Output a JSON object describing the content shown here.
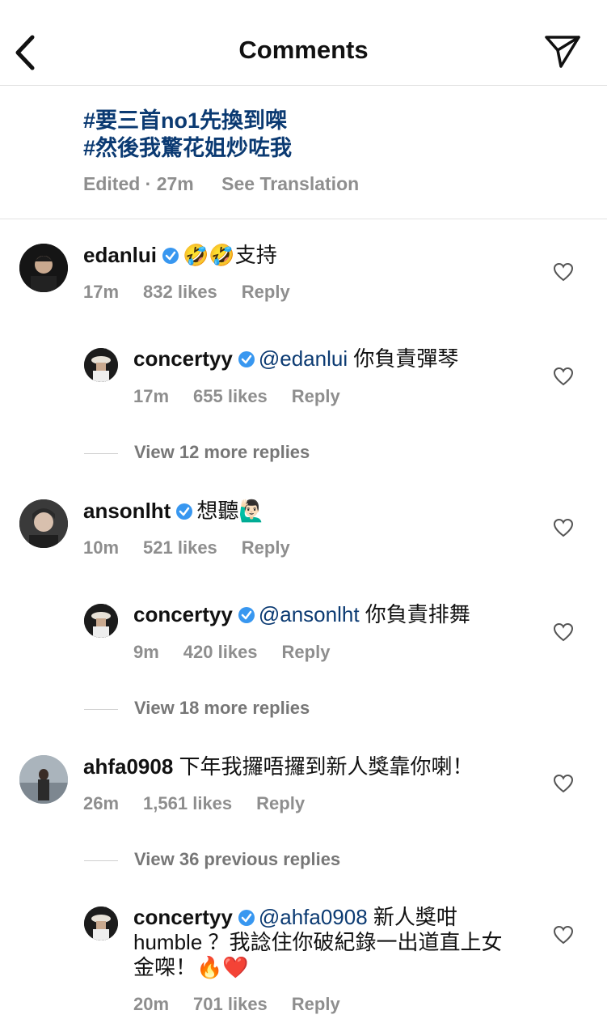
{
  "header": {
    "title": "Comments",
    "back_icon": "chevron-left-icon",
    "send_icon": "paper-plane-icon"
  },
  "caption": {
    "hashtags": [
      "#要三首no1先換到㗎",
      "#然後我驚花姐炒咗我"
    ],
    "edited": "Edited · 27m",
    "see_translation": "See Translation"
  },
  "comments": [
    {
      "username": "edanlui",
      "verified": true,
      "text": "🤣🤣支持",
      "time": "17m",
      "likes": "832 likes",
      "reply": "Reply",
      "replies": [
        {
          "username": "concertyy",
          "verified": true,
          "mention": "@edanlui",
          "text": " 你負責彈琴",
          "time": "17m",
          "likes": "655 likes",
          "reply": "Reply"
        }
      ],
      "view_more": "View 12 more replies"
    },
    {
      "username": "ansonlht",
      "verified": true,
      "text": "想聽🙋🏻‍♂️",
      "time": "10m",
      "likes": "521 likes",
      "reply": "Reply",
      "replies": [
        {
          "username": "concertyy",
          "verified": true,
          "mention": "@ansonlht",
          "text": " 你負責排舞",
          "time": "9m",
          "likes": "420 likes",
          "reply": "Reply"
        }
      ],
      "view_more": "View 18 more replies"
    },
    {
      "username": "ahfa0908",
      "verified": false,
      "text": " 下年我攞唔攞到新人獎靠你喇！",
      "time": "26m",
      "likes": "1,561 likes",
      "reply": "Reply",
      "view_previous": "View 36 previous replies",
      "replies": [
        {
          "username": "concertyy",
          "verified": true,
          "mention": "@ahfa0908",
          "text": " 新人獎咁humble ？我諗住你破紀錄一出道直上女金㗎！🔥❤️",
          "time": "20m",
          "likes": "701 likes",
          "reply": "Reply"
        }
      ]
    }
  ],
  "colors": {
    "mention": "#0b3a72",
    "meta": "#8e8e8e",
    "verified": "#3897f0"
  }
}
